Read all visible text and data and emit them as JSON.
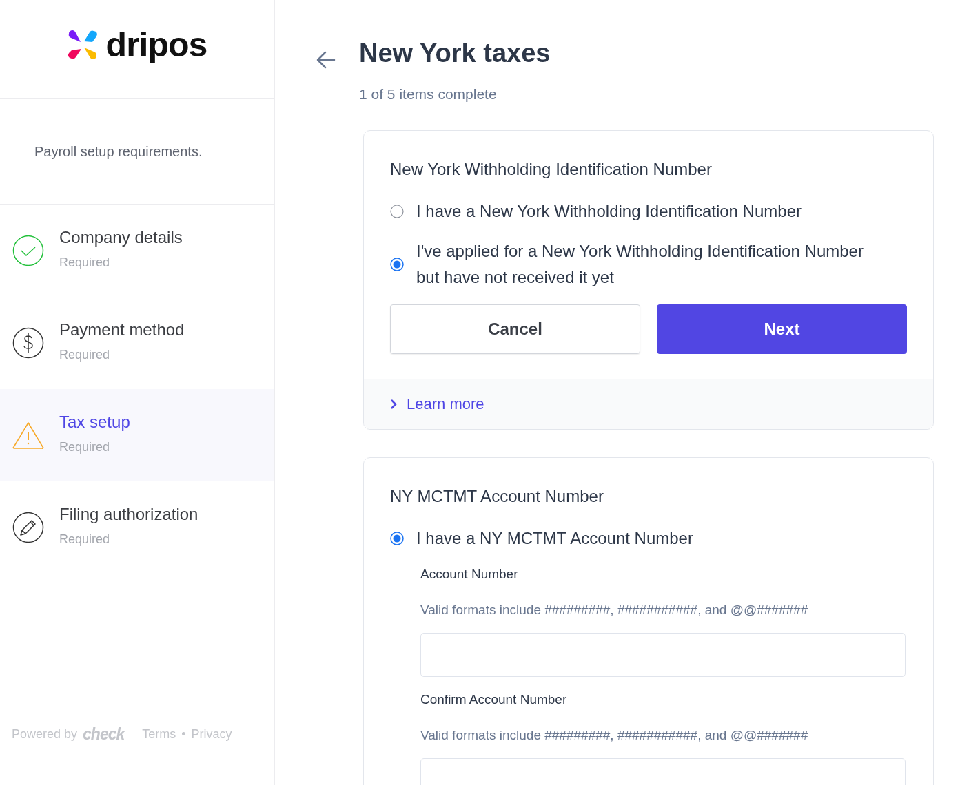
{
  "brand": {
    "name": "dripos"
  },
  "sidebar": {
    "intro": "Payroll setup requirements.",
    "items": [
      {
        "label": "Company details",
        "sublabel": "Required",
        "kind": "complete",
        "selected": false
      },
      {
        "label": "Payment method",
        "sublabel": "Required",
        "kind": "payment",
        "selected": false
      },
      {
        "label": "Tax setup",
        "sublabel": "Required",
        "kind": "warning",
        "selected": true
      },
      {
        "label": "Filing authorization",
        "sublabel": "Required",
        "kind": "signature",
        "selected": false
      }
    ],
    "footer": {
      "powered_by": "Powered by",
      "provider": "check",
      "links": [
        "Terms",
        "Privacy"
      ],
      "separator": "•"
    }
  },
  "header": {
    "title": "New York taxes",
    "progress": "1 of 5 items complete"
  },
  "cards": [
    {
      "title": "New York Withholding Identification Number",
      "options": [
        {
          "label": "I have a New York Withholding Identification Number",
          "selected": false
        },
        {
          "label": "I've applied for a New York Withholding Identification Number but have not received it yet",
          "selected": true
        }
      ],
      "buttons": [
        {
          "label": "Cancel",
          "kind": "secondary"
        },
        {
          "label": "Next",
          "kind": "primary"
        }
      ],
      "footer_link": "Learn more"
    },
    {
      "title": "NY MCTMT Account Number",
      "options": [
        {
          "label": "I have a NY MCTMT Account Number",
          "selected": true
        }
      ],
      "fields": [
        {
          "label": "Account Number",
          "hint": "Valid formats include #########, ###########, and @@#######"
        },
        {
          "label": "Confirm Account Number",
          "hint": "Valid formats include #########, ###########, and @@#######"
        }
      ]
    }
  ]
}
